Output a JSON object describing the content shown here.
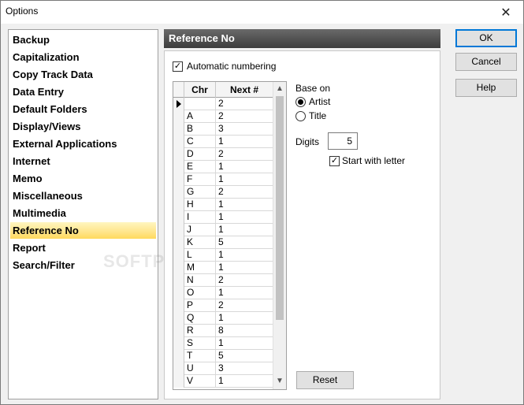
{
  "window": {
    "title": "Options",
    "close_glyph": "✕"
  },
  "categories": [
    "Backup",
    "Capitalization",
    "Copy Track Data",
    "Data Entry",
    "Default Folders",
    "Display/Views",
    "External Applications",
    "Internet",
    "Memo",
    "Miscellaneous",
    "Multimedia",
    "Reference No",
    "Report",
    "Search/Filter"
  ],
  "selected_category": "Reference No",
  "watermark": "SOFTPEDIA",
  "panel": {
    "title": "Reference No",
    "auto_numbering_label": "Automatic numbering",
    "auto_numbering_checked": true,
    "grid": {
      "columns": [
        "Chr",
        "Next #"
      ],
      "rows": [
        [
          "",
          "2"
        ],
        [
          "A",
          "2"
        ],
        [
          "B",
          "3"
        ],
        [
          "C",
          "1"
        ],
        [
          "D",
          "2"
        ],
        [
          "E",
          "1"
        ],
        [
          "F",
          "1"
        ],
        [
          "G",
          "2"
        ],
        [
          "H",
          "1"
        ],
        [
          "I",
          "1"
        ],
        [
          "J",
          "1"
        ],
        [
          "K",
          "5"
        ],
        [
          "L",
          "1"
        ],
        [
          "M",
          "1"
        ],
        [
          "N",
          "2"
        ],
        [
          "O",
          "1"
        ],
        [
          "P",
          "2"
        ],
        [
          "Q",
          "1"
        ],
        [
          "R",
          "8"
        ],
        [
          "S",
          "1"
        ],
        [
          "T",
          "5"
        ],
        [
          "U",
          "3"
        ],
        [
          "V",
          "1"
        ]
      ]
    },
    "base_on_label": "Base on",
    "base_on_options": [
      "Artist",
      "Title"
    ],
    "base_on_selected": "Artist",
    "digits_label": "Digits",
    "digits_value": "5",
    "start_with_letter_label": "Start with letter",
    "start_with_letter_checked": true,
    "reset_label": "Reset"
  },
  "buttons": {
    "ok": "OK",
    "cancel": "Cancel",
    "help": "Help"
  },
  "colors": {
    "selection": "#ffe58a",
    "default_button_border": "#0078d7",
    "header_bg": "#4a4a4a"
  }
}
